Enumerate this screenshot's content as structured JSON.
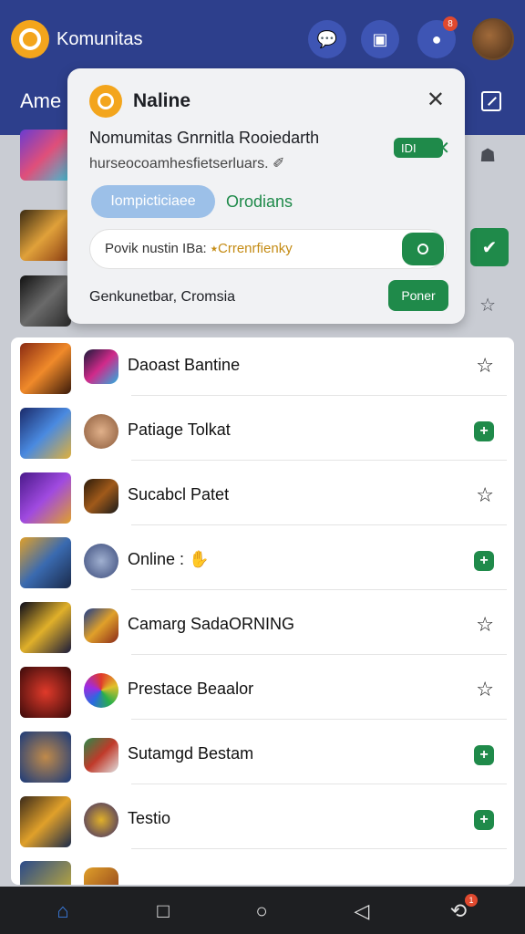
{
  "app": {
    "title": "Komunitas",
    "subtitle": "Ame",
    "notification_count": "8",
    "nav_badge": "1"
  },
  "popup": {
    "title": "Naline",
    "heading": "Nomumitas Gnrnitla Rooiedarth",
    "subtext": "hurseocoamhesfietserluars. ✐",
    "toggle_label": "IDI",
    "chip_blue": "Iompicticiaee",
    "chip_text": "Orodians",
    "search_text": "Povik nustin IBa:",
    "search_accent": "⭑Crrenrfienky",
    "footer_text": "Genkunetbar, Cromsia",
    "footer_button": "Poner"
  },
  "list": {
    "rows": [
      {
        "label": "Daoast Bantine",
        "action": "star"
      },
      {
        "label": "Patiage Tolkat",
        "action": "plus"
      },
      {
        "label": "Sucabcl Patet",
        "action": "star"
      },
      {
        "label": "Online : ✋",
        "action": "plus"
      },
      {
        "label": "Camarg SadaORNING",
        "action": "star"
      },
      {
        "label": "Prestace Beaalor",
        "action": "star"
      },
      {
        "label": "Sutamgd Bestam",
        "action": "plus"
      },
      {
        "label": "Testio",
        "action": "plus"
      }
    ]
  },
  "icons": {
    "star": "☆",
    "plus": "+",
    "close": "✕",
    "home": "⌂",
    "square": "□",
    "circle": "○",
    "back": "◁",
    "chat": "✉"
  }
}
